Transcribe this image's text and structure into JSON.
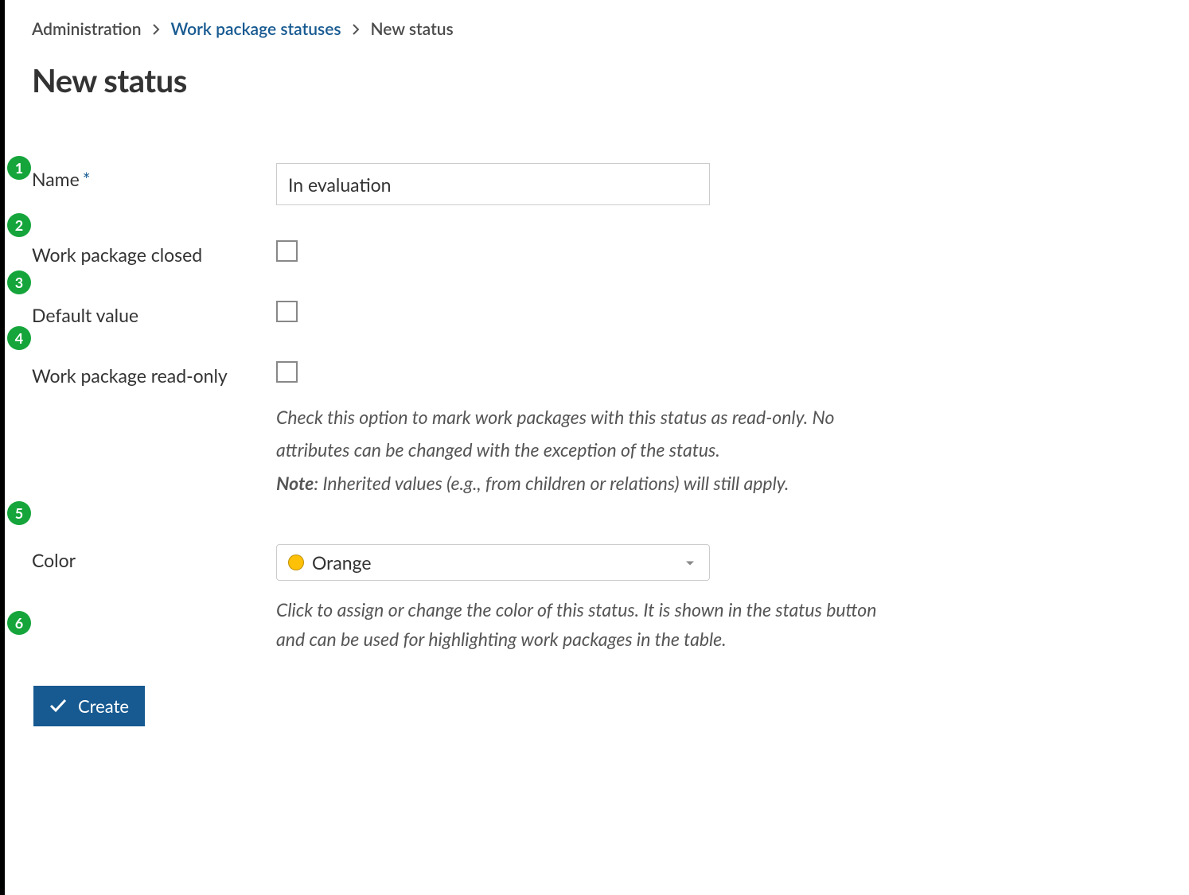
{
  "breadcrumb": {
    "root": "Administration",
    "link": "Work package statuses",
    "current": "New status"
  },
  "page_title": "New status",
  "fields": {
    "name": {
      "label": "Name",
      "value": "In evaluation",
      "required_mark": "*"
    },
    "closed": {
      "label": "Work package closed"
    },
    "default": {
      "label": "Default value"
    },
    "readonly": {
      "label": "Work package read-only",
      "help_line1": "Check this option to mark work packages with this status as read-only. No attributes can be changed with the exception of the status.",
      "note_label": "Note",
      "note_text": ": Inherited values (e.g., from children or relations) will still apply."
    },
    "color": {
      "label": "Color",
      "value": "Orange",
      "swatch_hex": "#FFC107",
      "help": "Click to assign or change the color of this status. It is shown in the status button and can be used for highlighting work packages in the table."
    }
  },
  "buttons": {
    "create": "Create"
  },
  "annotations": [
    "1",
    "2",
    "3",
    "4",
    "5",
    "6"
  ]
}
